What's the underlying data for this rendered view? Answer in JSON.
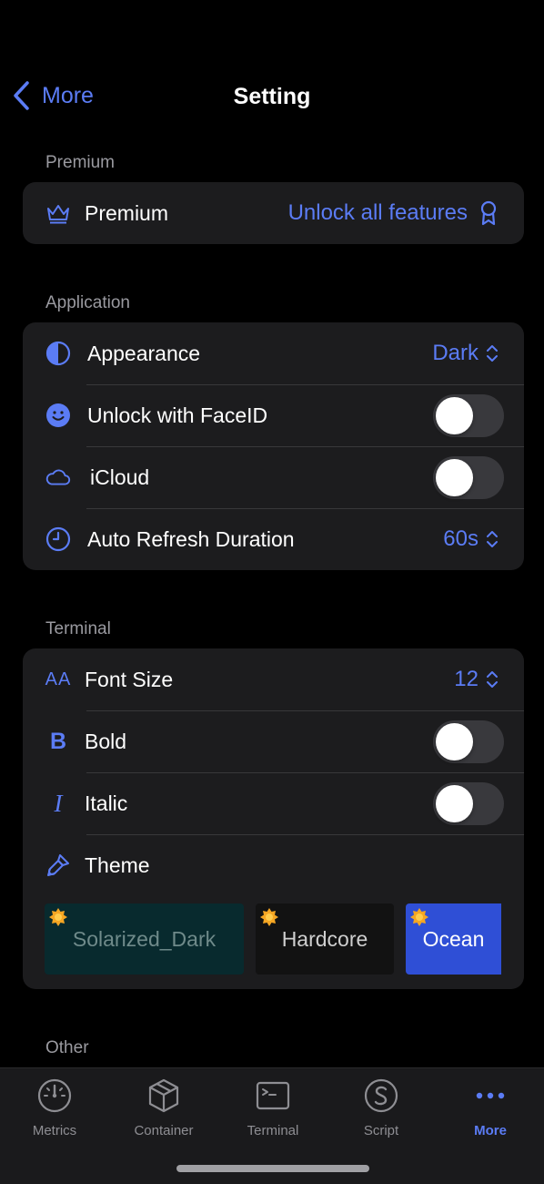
{
  "nav": {
    "back_label": "More",
    "title": "Setting"
  },
  "sections": {
    "premium": {
      "header": "Premium",
      "row_label": "Premium",
      "row_value": "Unlock all features"
    },
    "application": {
      "header": "Application",
      "appearance": {
        "label": "Appearance",
        "value": "Dark"
      },
      "faceid": {
        "label": "Unlock with FaceID",
        "on": false
      },
      "icloud": {
        "label": "iCloud",
        "on": false
      },
      "refresh": {
        "label": "Auto Refresh Duration",
        "value": "60s"
      }
    },
    "terminal": {
      "header": "Terminal",
      "font_size": {
        "label": "Font Size",
        "value": "12",
        "icon_text": "AA"
      },
      "bold": {
        "label": "Bold",
        "on": false,
        "icon_text": "B"
      },
      "italic": {
        "label": "Italic",
        "on": false,
        "icon_text": "I"
      },
      "theme": {
        "label": "Theme",
        "options": [
          "Solarized_Dark",
          "Hardcore",
          "Ocean"
        ],
        "selected": "Ocean"
      }
    },
    "other": {
      "header": "Other"
    }
  },
  "tabbar": {
    "tabs": [
      "Metrics",
      "Container",
      "Terminal",
      "Script",
      "More"
    ],
    "active": "More"
  },
  "colors": {
    "accent": "#5b7cf5",
    "background": "#000000",
    "card": "#1c1c1e"
  }
}
